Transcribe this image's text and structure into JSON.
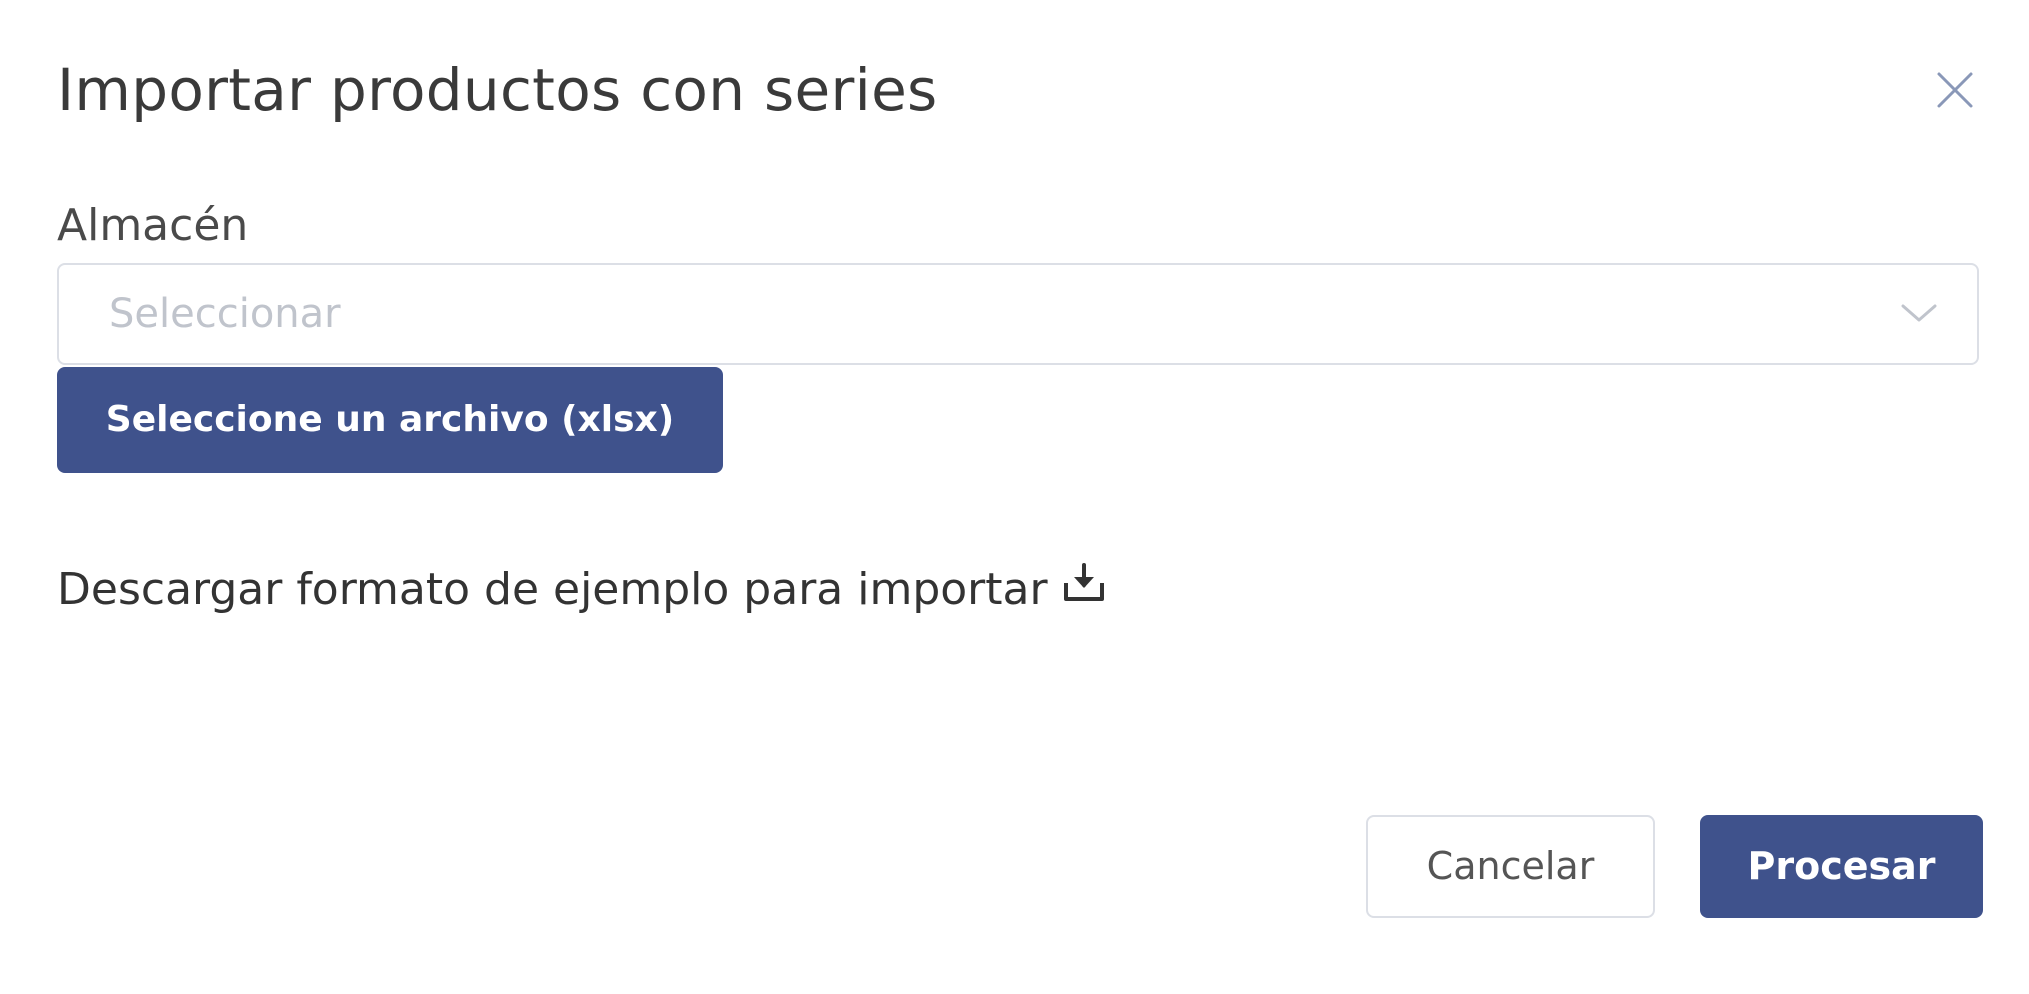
{
  "dialog": {
    "title": "Importar productos con series",
    "close_icon": "close-icon"
  },
  "warehouse": {
    "label": "Almacén",
    "placeholder": "Seleccionar",
    "arrow_icon": "chevron-down-icon"
  },
  "file": {
    "button_label": "Seleccione un archivo (xlsx)"
  },
  "download": {
    "link_text": "Descargar formato de ejemplo para importar",
    "icon": "download-icon"
  },
  "footer": {
    "cancel_label": "Cancelar",
    "process_label": "Procesar"
  },
  "colors": {
    "primary": "#3f528c",
    "border": "#dcdfe6",
    "placeholder": "#c0c4cc",
    "close_icon": "#8a98b8"
  }
}
